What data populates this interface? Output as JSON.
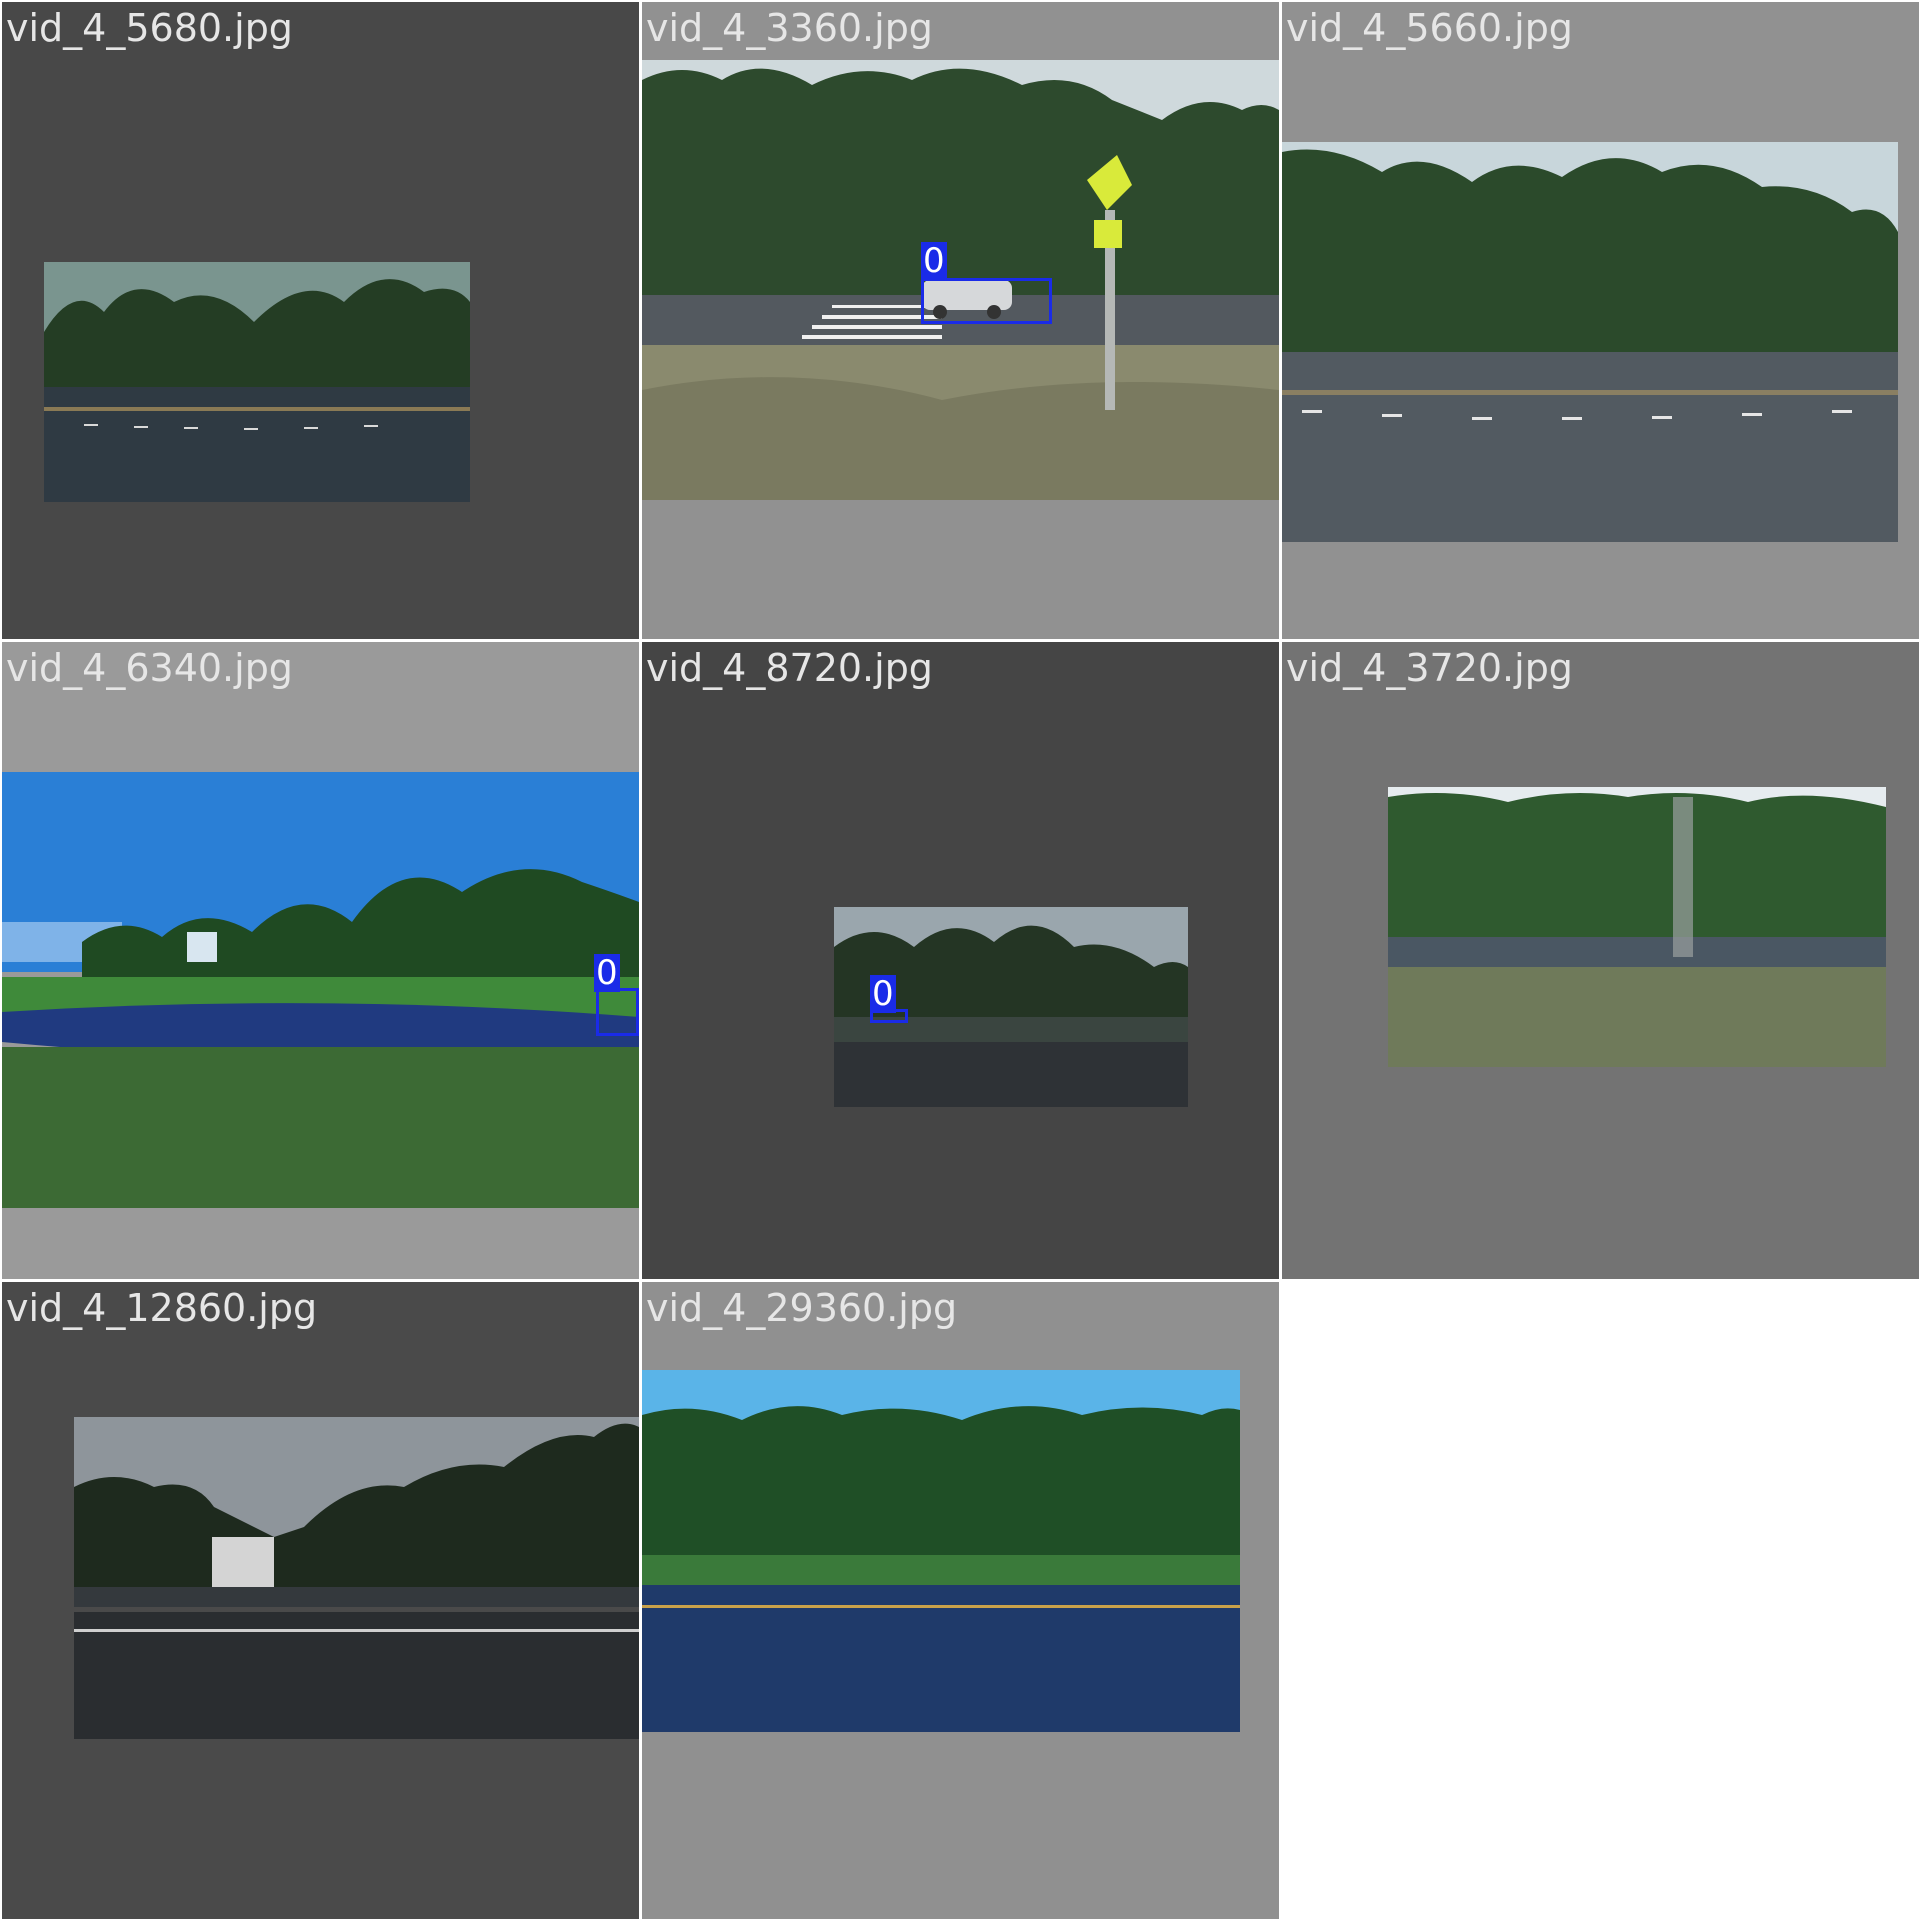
{
  "tiles": [
    {
      "filename": "vid_4_5680.jpg",
      "background": "#484848",
      "detections": []
    },
    {
      "filename": "vid_4_3360.jpg",
      "background": "#919191",
      "detections": [
        {
          "class_label": "0"
        }
      ]
    },
    {
      "filename": "vid_4_5660.jpg",
      "background": "#919191",
      "detections": []
    },
    {
      "filename": "vid_4_6340.jpg",
      "background": "#9a9a9a",
      "detections": [
        {
          "class_label": "0"
        }
      ]
    },
    {
      "filename": "vid_4_8720.jpg",
      "background": "#454545",
      "detections": [
        {
          "class_label": "0"
        }
      ]
    },
    {
      "filename": "vid_4_3720.jpg",
      "background": "#737373",
      "detections": []
    },
    {
      "filename": "vid_4_12860.jpg",
      "background": "#4a4a4a",
      "detections": []
    },
    {
      "filename": "vid_4_29360.jpg",
      "background": "#909090",
      "detections": []
    }
  ],
  "colors": {
    "detection_box": "#1a2be8",
    "label_text": "#e6e6e6"
  }
}
